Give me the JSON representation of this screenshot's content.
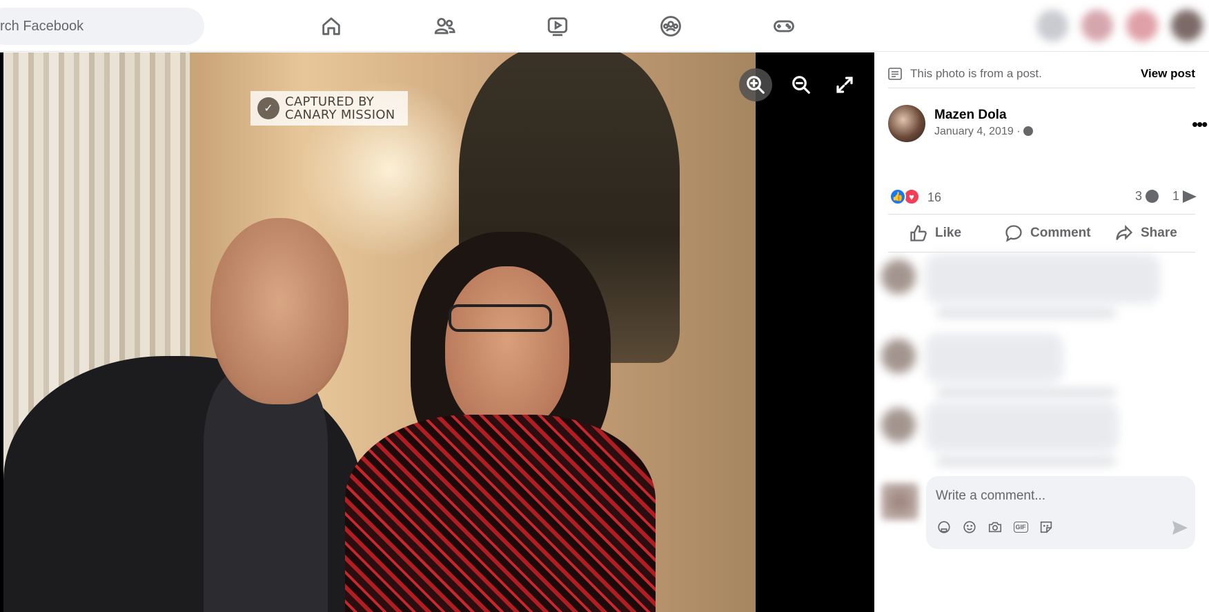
{
  "header": {
    "search_placeholder": "rch Facebook",
    "nav": [
      {
        "name": "home-icon"
      },
      {
        "name": "friends-icon"
      },
      {
        "name": "watch-icon"
      },
      {
        "name": "groups-icon"
      },
      {
        "name": "gaming-icon"
      }
    ]
  },
  "photo": {
    "watermark_line1": "CAPTURED BY",
    "watermark_line2": "CANARY MISSION",
    "tools": [
      "zoom-in-icon",
      "zoom-out-icon",
      "fullscreen-icon"
    ]
  },
  "panel": {
    "from_post_text": "This photo is from a post.",
    "view_post_label": "View post",
    "author_name": "Mazen Dola",
    "post_date": "January 4, 2019 ·",
    "more_label": "•••",
    "reaction_count": "16",
    "comment_count": "3",
    "share_count": "1",
    "actions": {
      "like": "Like",
      "comment": "Comment",
      "share": "Share"
    },
    "comment_placeholder": "Write a comment...",
    "composer_tools": [
      "avatar-sticker-icon",
      "emoji-icon",
      "camera-icon",
      "gif-icon",
      "sticker-icon"
    ],
    "gif_label": "GIF"
  },
  "colors": {
    "like_blue": "#1877f2",
    "love_red": "#f33e58",
    "secondary_text": "#65676b",
    "divider": "#dadde1"
  }
}
